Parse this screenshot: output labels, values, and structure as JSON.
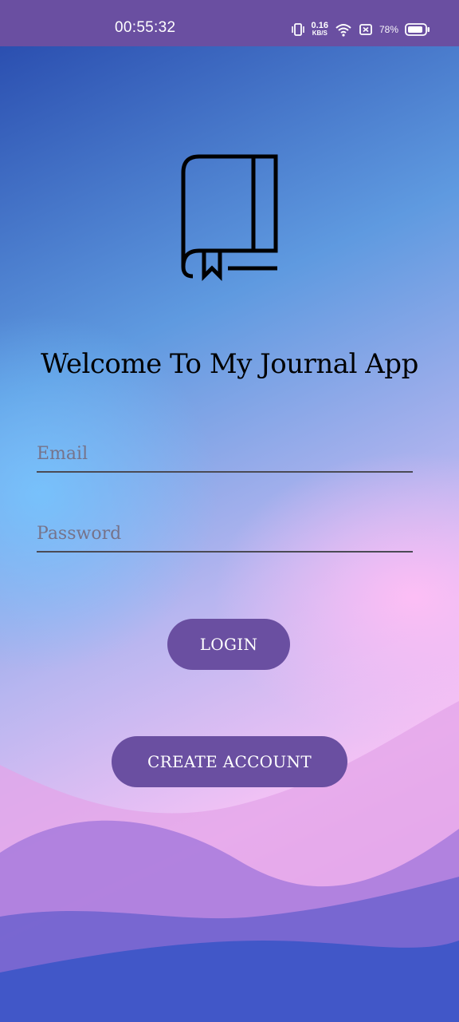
{
  "status_bar": {
    "time": "00:55:32",
    "net_speed_value": "0.16",
    "net_speed_unit": "KB/S",
    "battery_percent": "78%",
    "icons": [
      "vibrate-icon",
      "wifi-icon",
      "no-sim-icon",
      "battery-icon"
    ]
  },
  "app": {
    "logo_icon": "journal-book-icon",
    "welcome_title": "Welcome To My Journal App",
    "email_placeholder": "Email",
    "email_value": "",
    "password_placeholder": "Password",
    "password_value": "",
    "login_label": "LOGIN",
    "create_account_label": "CREATE ACCOUNT"
  },
  "colors": {
    "status_bar_bg": "#6a4fa1",
    "button_bg": "#6a4fa1",
    "button_text": "#ffffff",
    "title_text": "#000000"
  }
}
